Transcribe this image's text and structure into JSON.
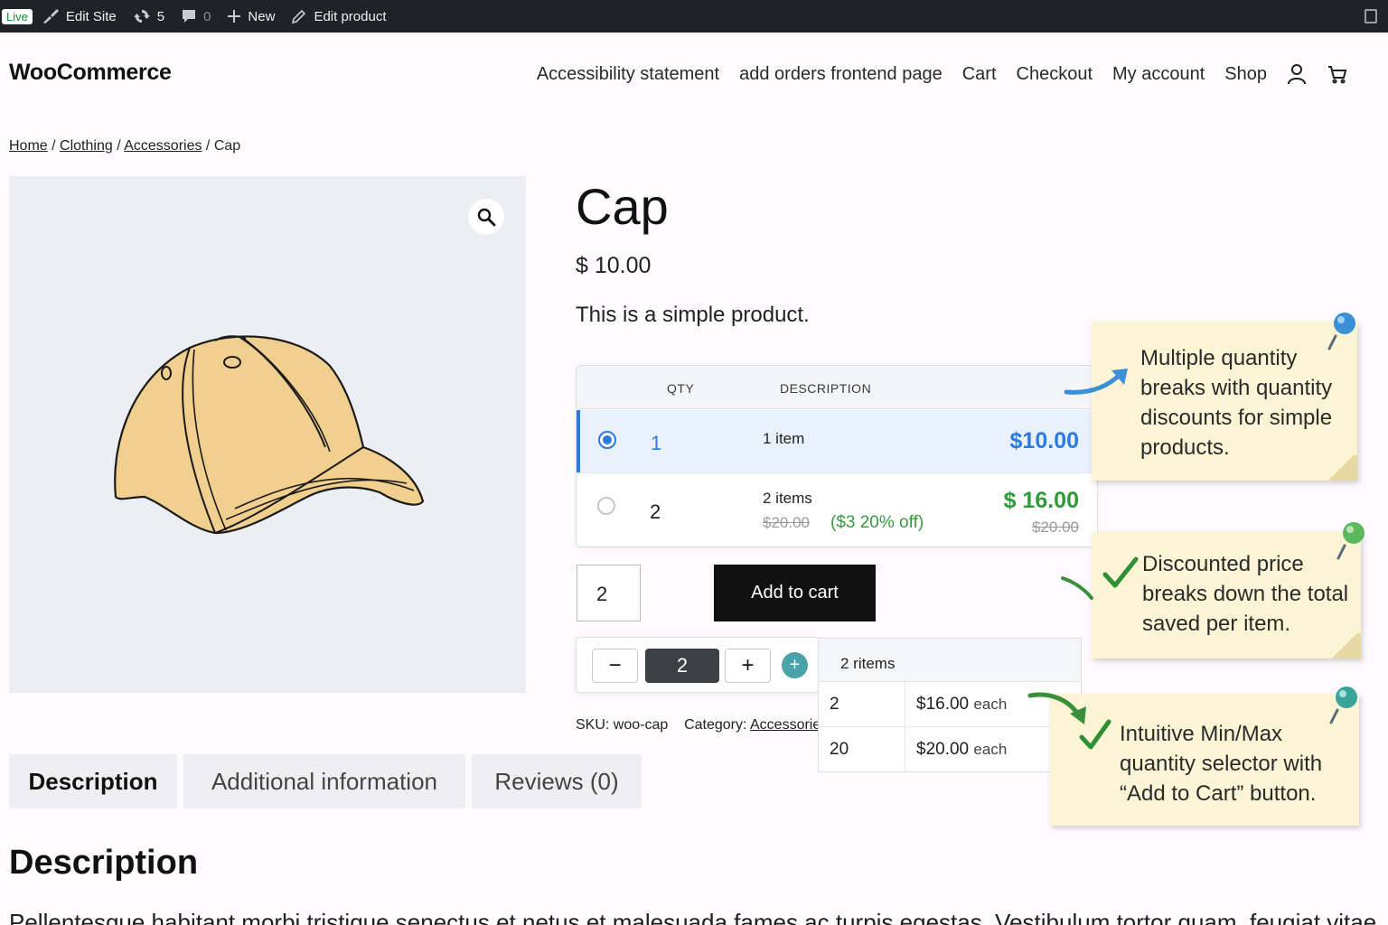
{
  "admin_bar": {
    "live": "Live",
    "edit_site": "Edit Site",
    "updates": "5",
    "comments": "0",
    "new": "New",
    "edit_product": "Edit product"
  },
  "site": {
    "title": "WooCommerce"
  },
  "nav": {
    "items": [
      "Accessibility statement",
      "add orders frontend page",
      "Cart",
      "Checkout",
      "My account",
      "Shop"
    ]
  },
  "breadcrumb": {
    "home": "Home",
    "clothing": "Clothing",
    "accessories": "Accessories",
    "current": "Cap",
    "sep": "/"
  },
  "product": {
    "title": "Cap",
    "price": "$ 10.00",
    "short_description": "This is a simple product.",
    "qty_value": "2",
    "add_to_cart": "Add to cart",
    "sku_label": "SKU:",
    "sku": "woo-cap",
    "category_label": "Category:",
    "category": "Accessories"
  },
  "tiers": {
    "headers": {
      "qty": "QTY",
      "description": "DESCRIPTION"
    },
    "rows": [
      {
        "qty": "1",
        "desc": "1 item",
        "price": "$10.00",
        "selected": true
      },
      {
        "qty": "2",
        "desc": "2 items",
        "old_total": "$20.00",
        "saving": "($3 20% off)",
        "price": "$ 16.00",
        "old_price": "$20.00",
        "selected": false
      }
    ]
  },
  "stepper": {
    "minus": "−",
    "value": "2",
    "plus": "+",
    "add": "+"
  },
  "ranges": {
    "header": "2 ritems",
    "rows": [
      {
        "qty": "2",
        "price": "$16.00",
        "unit": "each"
      },
      {
        "qty": "20",
        "price": "$20.00",
        "unit": "each"
      }
    ]
  },
  "tabs": [
    "Description",
    "Additional information",
    "Reviews (0)"
  ],
  "description": {
    "title": "Description",
    "text": "Pellentesque habitant morbi tristique senectus et netus et malesuada fames ac turpis egestas. Vestibulum tortor quam, feugiat vitae"
  },
  "notes": [
    {
      "text": [
        "Multiple quantity",
        "breaks with quantity",
        "discounts for simple",
        "products."
      ]
    },
    {
      "text": [
        "Discounted price",
        "breaks down the total",
        "saved per item."
      ]
    },
    {
      "text": [
        "Intuitive Min/Max",
        "quantity selector with",
        "“Add to Cart” button."
      ]
    }
  ],
  "colors": {
    "accent": "#2e7be0",
    "green": "#2f9a3a",
    "note": "#fbf5d6",
    "pin_blue": "#3b8fd6",
    "pin_green": "#5cb85c"
  }
}
